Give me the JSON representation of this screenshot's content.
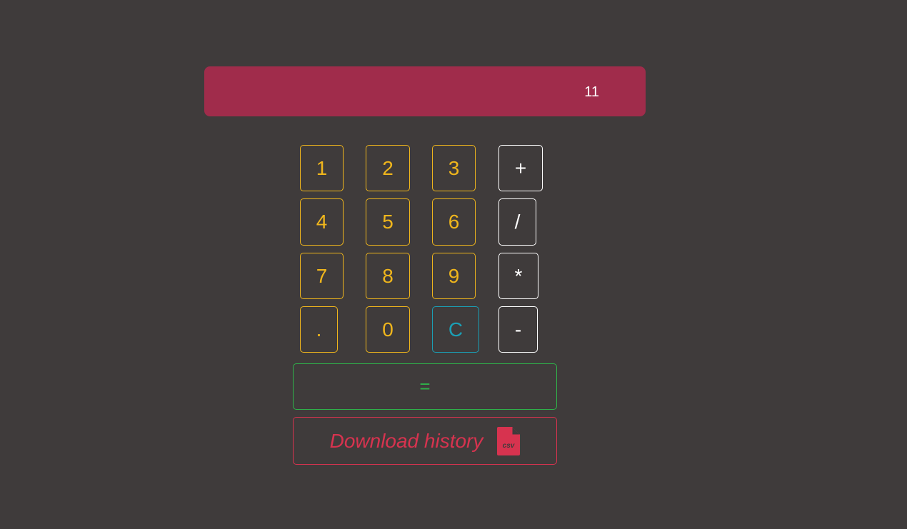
{
  "display": {
    "value": "11"
  },
  "keys": {
    "k1": "1",
    "k2": "2",
    "k3": "3",
    "plus": "+",
    "k4": "4",
    "k5": "5",
    "k6": "6",
    "divide": "/",
    "k7": "7",
    "k8": "8",
    "k9": "9",
    "multiply": "*",
    "dot": ".",
    "k0": "0",
    "clear": "C",
    "minus": "-"
  },
  "equals_label": "=",
  "download": {
    "label": "Download history",
    "icon": "csv-file-icon",
    "icon_text": "csv"
  },
  "colors": {
    "background": "#3f3b3b",
    "display": "#a02c4b",
    "number_keys": "#f0b61c",
    "operator_keys": "#ffffff",
    "clear_key": "#1b9fb5",
    "equals": "#2fb24a",
    "download": "#d7334f"
  }
}
